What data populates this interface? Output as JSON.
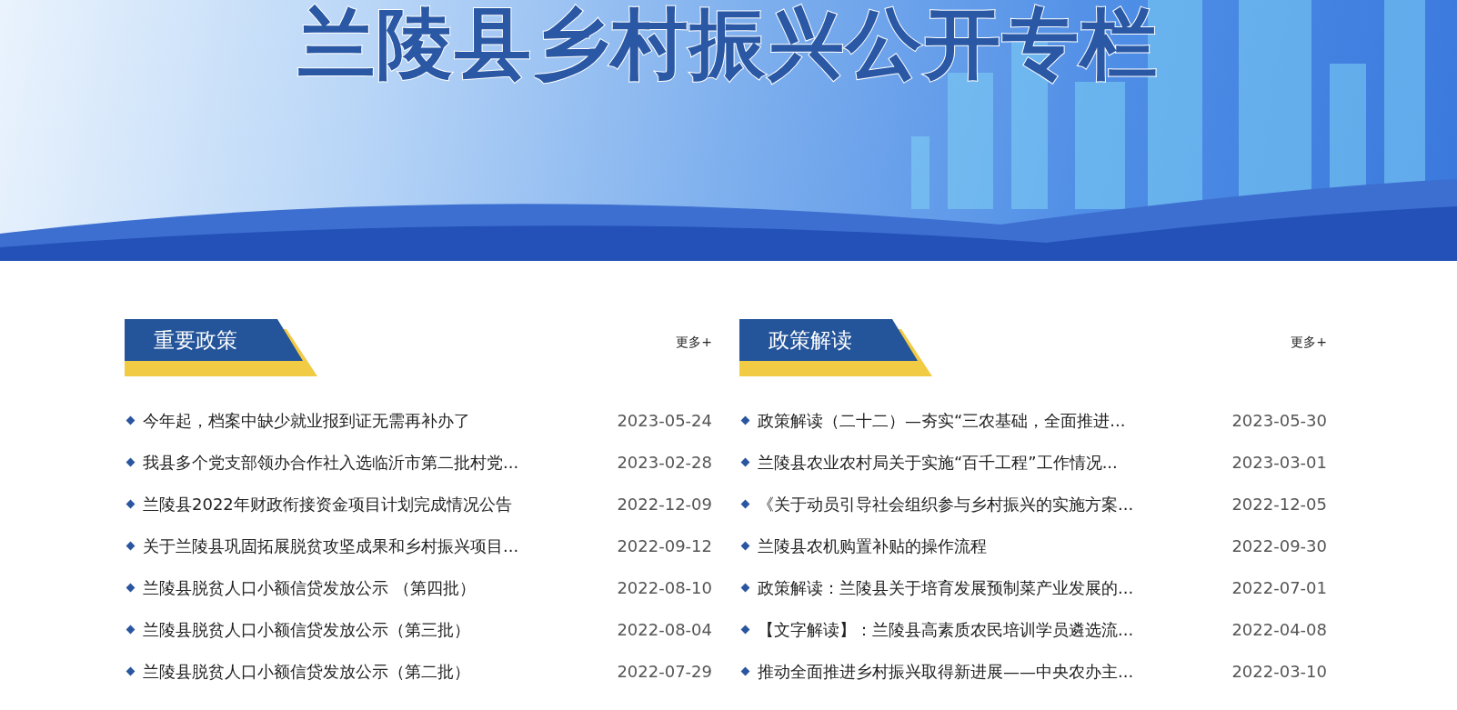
{
  "banner": {
    "title": "兰陵县乡村振兴公开专栏"
  },
  "sections": [
    {
      "title": "重要政策",
      "more": "更多+",
      "items": [
        {
          "title": "今年起，档案中缺少就业报到证无需再补办了",
          "date": "2023-05-24"
        },
        {
          "title": "我县多个党支部领办合作社入选临沂市第二批村党...",
          "date": "2023-02-28"
        },
        {
          "title": "兰陵县2022年财政衔接资金项目计划完成情况公告",
          "date": "2022-12-09"
        },
        {
          "title": "关于兰陵县巩固拓展脱贫攻坚成果和乡村振兴项目...",
          "date": "2022-09-12"
        },
        {
          "title": "兰陵县脱贫人口小额信贷发放公示 （第四批）",
          "date": "2022-08-10"
        },
        {
          "title": "兰陵县脱贫人口小额信贷发放公示（第三批）",
          "date": "2022-08-04"
        },
        {
          "title": "兰陵县脱贫人口小额信贷发放公示（第二批）",
          "date": "2022-07-29"
        }
      ]
    },
    {
      "title": "政策解读",
      "more": "更多+",
      "items": [
        {
          "title": "政策解读（二十二）—夯实“三农基础，全面推进...",
          "date": "2023-05-30"
        },
        {
          "title": "兰陵县农业农村局关于实施“百千工程”工作情况...",
          "date": "2023-03-01"
        },
        {
          "title": "《关于动员引导社会组织参与乡村振兴的实施方案...",
          "date": "2022-12-05"
        },
        {
          "title": "兰陵县农机购置补贴的操作流程",
          "date": "2022-09-30"
        },
        {
          "title": "政策解读：兰陵县关于培育发展预制菜产业发展的...",
          "date": "2022-07-01"
        },
        {
          "title": "【文字解读】：兰陵县高素质农民培训学员遴选流...",
          "date": "2022-04-08"
        },
        {
          "title": "推动全面推进乡村振兴取得新进展——中央农办主...",
          "date": "2022-03-10"
        }
      ]
    }
  ]
}
